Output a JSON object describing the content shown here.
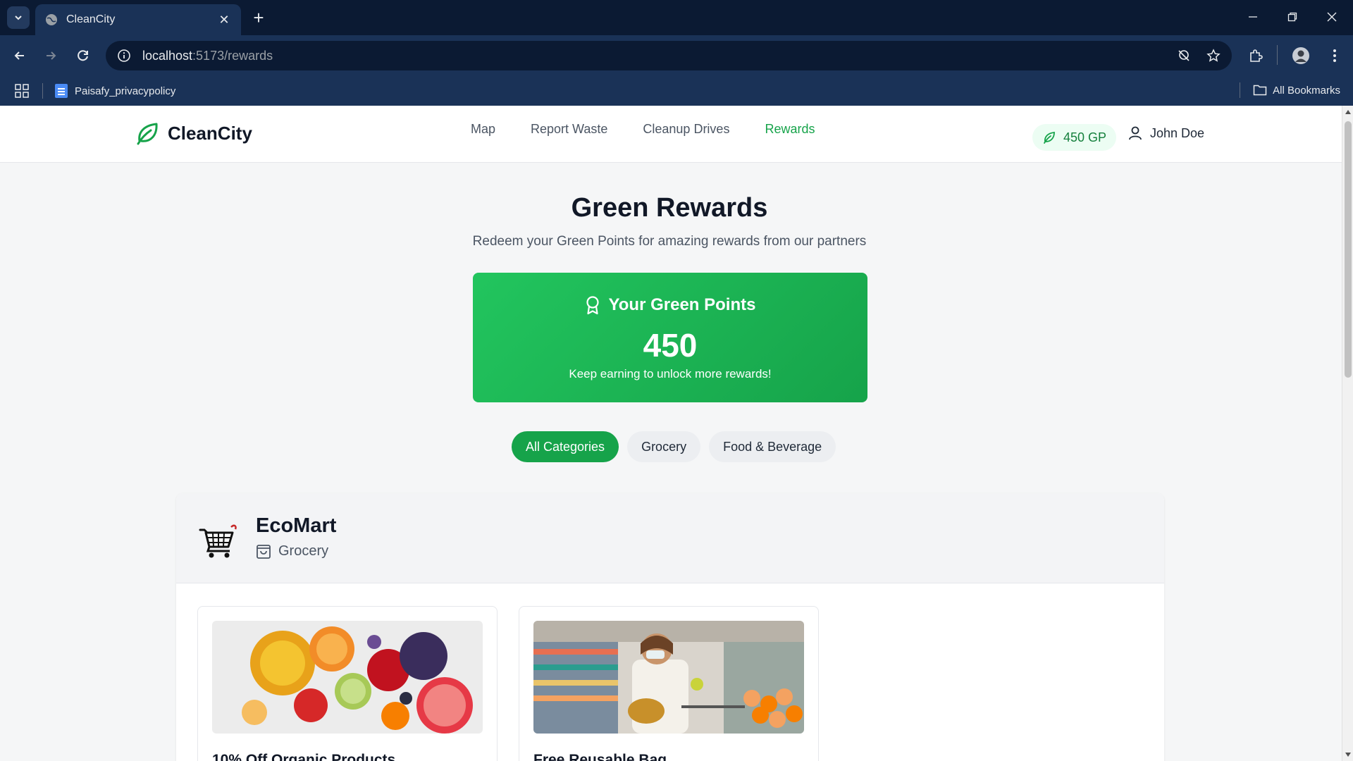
{
  "browser": {
    "tab_title": "CleanCity",
    "url_host": "localhost",
    "url_path": ":5173/rewards",
    "bookmark_label": "Paisafy_privacypolicy",
    "all_bookmarks_label": "All Bookmarks"
  },
  "nav": {
    "brand": "CleanCity",
    "links": [
      {
        "label": "Map"
      },
      {
        "label": "Report Waste"
      },
      {
        "label": "Cleanup Drives"
      },
      {
        "label": "Rewards",
        "active": true
      }
    ],
    "points_pill": "450 GP",
    "user_name": "John Doe",
    "accent_color": "#16a34a"
  },
  "hero": {
    "title": "Green Rewards",
    "subtitle": "Redeem your Green Points for amazing rewards from our partners"
  },
  "points_card": {
    "heading": "Your Green Points",
    "value": "450",
    "note": "Keep earning to unlock more rewards!"
  },
  "filters": [
    {
      "label": "All Categories",
      "active": true
    },
    {
      "label": "Grocery"
    },
    {
      "label": "Food & Beverage"
    }
  ],
  "partners": [
    {
      "name": "EcoMart",
      "category": "Grocery",
      "logo_icon": "shopping-cart-icon",
      "rewards": [
        {
          "title": "10% Off Organic Products",
          "image": "fruit-platter-photo"
        },
        {
          "title": "Free Reusable Bag",
          "image": "grocery-shopper-photo"
        }
      ]
    }
  ]
}
